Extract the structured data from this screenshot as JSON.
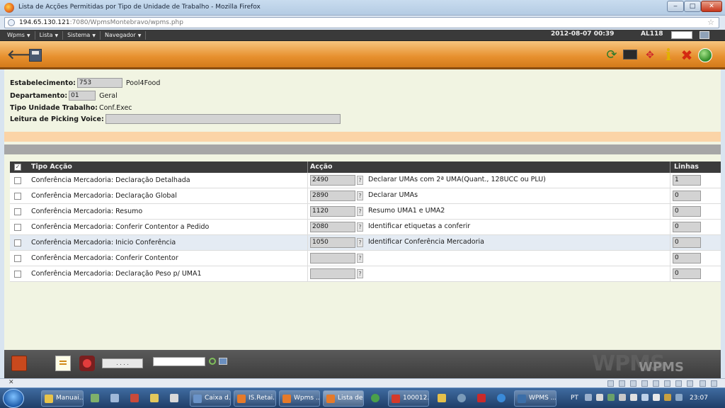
{
  "window": {
    "title": "Lista de Acções Permitidas por Tipo de Unidade de Trabalho - Mozilla Firefox",
    "min_label": "‒",
    "max_label": "□",
    "close_label": "✕"
  },
  "address": {
    "host": "194.65.130.121",
    "path": ":7080/WpmsMontebravo/wpms.php"
  },
  "menubar": {
    "items": [
      "Wpms",
      "Lista",
      "Sistema",
      "Navegador"
    ],
    "datetime": "2012-08-07 00:39",
    "user": "AL118"
  },
  "form": {
    "estabelecimento": {
      "label": "Estabelecimento:",
      "code": "753",
      "name": "Pool4Food"
    },
    "departamento": {
      "label": "Departamento:",
      "code": "01",
      "name": "Geral"
    },
    "tipo_unidade": {
      "label": "Tipo Unidade Trabalho:",
      "value": "Conf.Exec"
    },
    "leitura": {
      "label": "Leitura de Picking Voice:",
      "value": ""
    }
  },
  "grid": {
    "headers": {
      "tipo": "Tipo Acção",
      "accao": "Acção",
      "linhas": "Linhas"
    },
    "rows": [
      {
        "tipo": "Conferência Mercadoria: Declaração Detalhada",
        "code": "2490",
        "desc": "Declarar UMAs com 2ª UMA(Quant., 128UCC ou PLU)",
        "linhas": "1"
      },
      {
        "tipo": "Conferência Mercadoria: Declaração Global",
        "code": "2890",
        "desc": "Declarar UMAs",
        "linhas": "0"
      },
      {
        "tipo": "Conferência Mercadoria: Resumo",
        "code": "1120",
        "desc": "Resumo UMA1 e UMA2",
        "linhas": "0"
      },
      {
        "tipo": "Conferência Mercadoria: Conferir Contentor a Pedido",
        "code": "2080",
        "desc": "Identificar etiquetas a conferir",
        "linhas": "0"
      },
      {
        "tipo": "Conferência Mercadoria: Inicio Conferência",
        "code": "1050",
        "desc": "Identificar Conferência Mercadoria",
        "linhas": "0"
      },
      {
        "tipo": "Conferência Mercadoria: Conferir Contentor",
        "code": "",
        "desc": "",
        "linhas": "0"
      },
      {
        "tipo": "Conferência Mercadoria: Declaração Peso p/ UMA1",
        "code": "",
        "desc": "",
        "linhas": "0"
      }
    ],
    "help_label": "?"
  },
  "bottombar": {
    "dots_label": ". . . .",
    "logo": "WPMS"
  },
  "taskbar": {
    "tasks": [
      "Manuai...",
      "Caixa d...",
      "IS.Retai...",
      "Wpms ...",
      "Lista de...",
      "100012...",
      "WPMS ..."
    ],
    "lang": "PT",
    "clock": "23:07"
  }
}
